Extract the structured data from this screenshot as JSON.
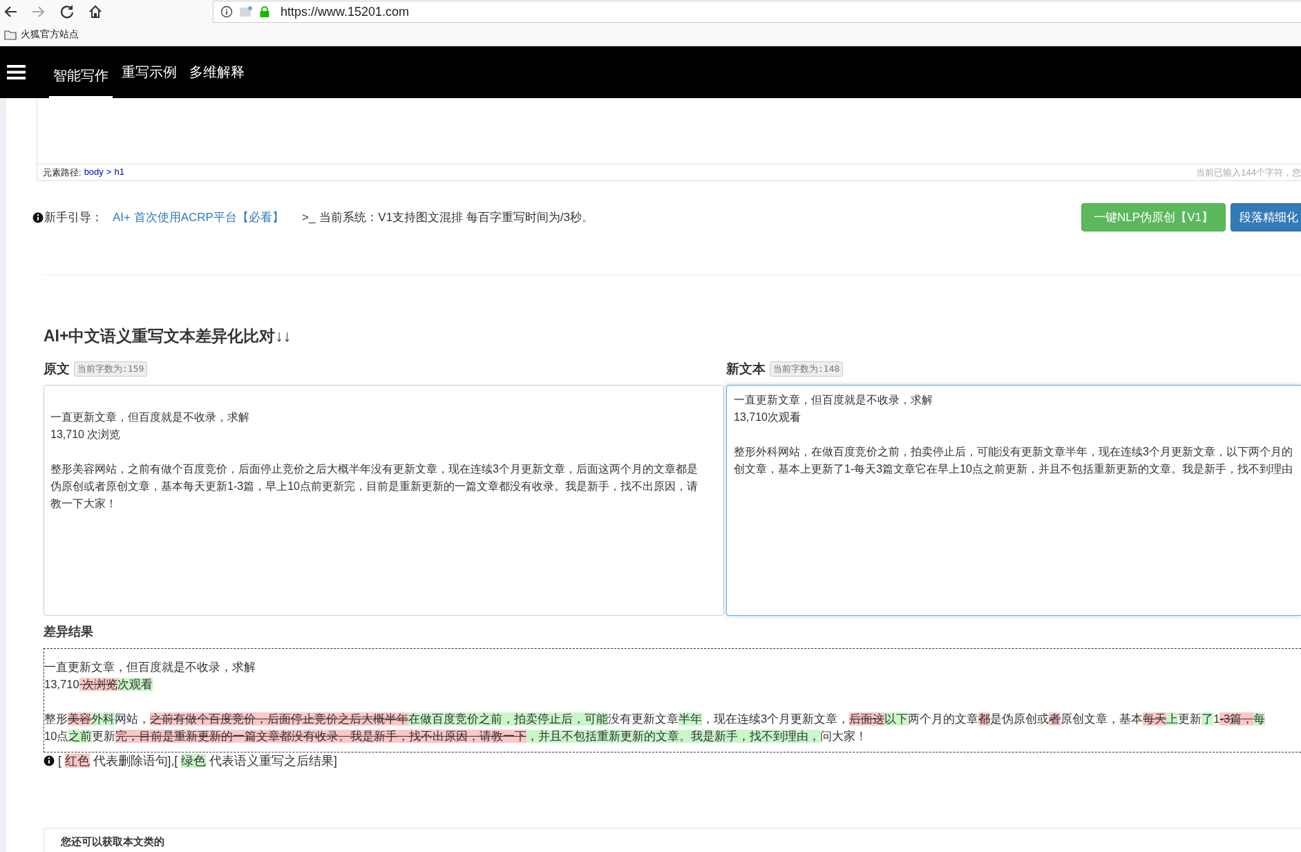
{
  "browser": {
    "url": "https://www.15201.com",
    "bookmarks": [
      {
        "label": "火狐官方站点"
      }
    ]
  },
  "navbar": {
    "tabs": [
      {
        "label": "智能写作",
        "selected": true
      },
      {
        "label": "重写示例",
        "selected": false
      },
      {
        "label": "多维解释",
        "selected": false
      }
    ]
  },
  "editor": {
    "path_label": "元素路径:",
    "path": [
      "body",
      "h1"
    ],
    "path_separator": ">",
    "status": "当前已输入144个字符，您"
  },
  "guide": {
    "label": "新手引导：",
    "link": "AI+ 首次使用ACRP平台【必看】",
    "prompt": ">_",
    "system": "当前系统：V1支持图文混排 每百字重写时间为/3秒。"
  },
  "actions": [
    {
      "label": "一键NLP伪原创【V1】",
      "kind": "success"
    },
    {
      "label": "段落精细化",
      "kind": "primary"
    }
  ],
  "compare": {
    "title": "AI+中文语义重写文本差异化比对↓↓",
    "panes": [
      {
        "label": "原文",
        "count": "当前字数为:159",
        "focused": false,
        "paragraphs": [
          [
            "一直更新文章，但百度就是不收录，求解",
            "13,710 次浏览"
          ],
          [
            "整形美容网站，之前有做个百度竞价，后面停止竞价之后大概半年没有更新文章，现在连续3个月更新文章，后面这两个月的文章都是",
            "伪原创或者原创文章，基本每天更新1-3篇，早上10点前更新完，目前是重新更新的一篇文章都没有收录。我是新手，找不出原因，请",
            "教一下大家！"
          ]
        ]
      },
      {
        "label": "新文本",
        "count": "当前字数为:148",
        "focused": true,
        "paragraphs": [
          [
            "一直更新文章，但百度就是不收录，求解",
            "13,710次观看"
          ],
          [
            "整形外科网站，在做百度竞价之前，拍卖停止后，可能没有更新文章半年，现在连续3个月更新文章，以下两个月的",
            "创文章，基本上更新了1-每天3篇文章它在早上10点之前更新，并且不包括重新更新的文章。我是新手，找不到理由"
          ]
        ]
      }
    ]
  },
  "diff": {
    "title": "差异结果",
    "paragraphs": [
      [
        [
          {
            "kind": "same",
            "text": "一直更新文章，但百度就是不收录，求解"
          }
        ],
        [
          {
            "kind": "same",
            "text": "13,710"
          },
          {
            "kind": "del",
            "text": " 次浏览"
          },
          {
            "kind": "ins",
            "text": "次观看"
          }
        ]
      ],
      [
        [
          {
            "kind": "same",
            "text": "整形"
          },
          {
            "kind": "del",
            "text": "美容"
          },
          {
            "kind": "ins",
            "text": "外科"
          },
          {
            "kind": "same",
            "text": "网站，"
          },
          {
            "kind": "del",
            "text": "之前有做个百度竞价，后面停止竞价之后大概半年"
          },
          {
            "kind": "ins",
            "text": "在做百度竞价之前，拍卖停止后，可能"
          },
          {
            "kind": "same",
            "text": "没有更新文章"
          },
          {
            "kind": "ins",
            "text": "半年"
          },
          {
            "kind": "same",
            "text": "，现在连续3个月更新文章，"
          },
          {
            "kind": "del",
            "text": "后面这"
          },
          {
            "kind": "ins",
            "text": "以下"
          },
          {
            "kind": "same",
            "text": "两个月的文章"
          },
          {
            "kind": "del",
            "text": "都"
          },
          {
            "kind": "same",
            "text": "是伪原创或"
          },
          {
            "kind": "del",
            "text": "者"
          },
          {
            "kind": "same",
            "text": "原创文章，基本"
          },
          {
            "kind": "del",
            "text": "每天"
          },
          {
            "kind": "ins",
            "text": "上"
          },
          {
            "kind": "same",
            "text": "更新"
          },
          {
            "kind": "ins",
            "text": "了"
          },
          {
            "kind": "same",
            "text": "1"
          },
          {
            "kind": "del",
            "text": "-3篇，"
          },
          {
            "kind": "ins",
            "text": "每"
          }
        ],
        [
          {
            "kind": "same",
            "text": "10点"
          },
          {
            "kind": "ins",
            "text": "之前"
          },
          {
            "kind": "same",
            "text": "更新"
          },
          {
            "kind": "del",
            "text": "完，目前是重新更新的一篇文章都没有收录。我是新手，找不出原因，请教一下"
          },
          {
            "kind": "ins",
            "text": "，并且不包括重新更新的文章。我是新手，找不到理由，"
          },
          {
            "kind": "same",
            "text": "问大家！"
          }
        ]
      ]
    ],
    "legend": [
      {
        "kind": "same",
        "text": "[ "
      },
      {
        "kind": "red",
        "text": "红色"
      },
      {
        "kind": "same",
        "text": " 代表删除语句],[ "
      },
      {
        "kind": "green",
        "text": "绿色"
      },
      {
        "kind": "same",
        "text": " 代表语义重写之后结果]"
      }
    ]
  },
  "bottom_card": {
    "title": "您还可以获取本文类的"
  }
}
